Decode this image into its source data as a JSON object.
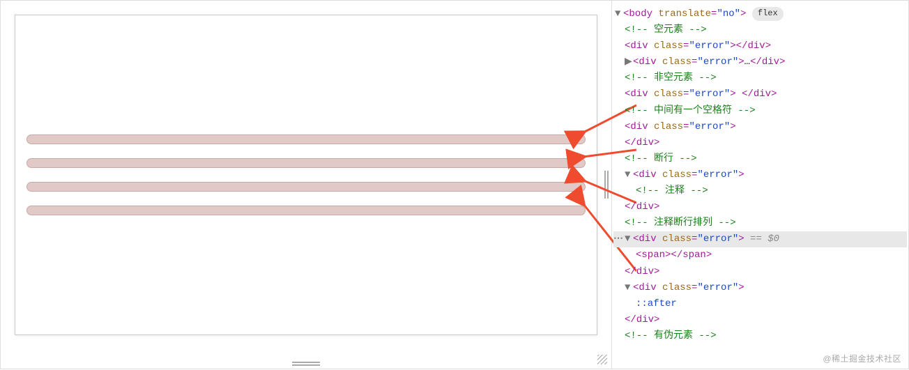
{
  "badge": "flex",
  "selection_marker": " == $0",
  "watermark": "@稀土掘金技术社区",
  "pseudo": "::after",
  "tags": {
    "body_open": "<body ",
    "attr_translate": "translate",
    "val_no": "\"no\"",
    "gt": ">",
    "div_open": "<div ",
    "attr_class": "class",
    "val_error": "\"error\"",
    "div_close": "</div>",
    "mid_close_open": "><",
    "slashdiv": "/div>",
    "span_open": "<span>",
    "span_close": "</span>",
    "ellipsis": "…"
  },
  "comments": {
    "empty_el": "<!-- 空元素 -->",
    "nonempty_el": "<!-- 非空元素 -->",
    "one_space": "<!-- 中间有一个空格符 -->",
    "line_break": "<!-- 断行 -->",
    "comment_inside": "<!-- 注释 -->",
    "comment_break": "<!-- 注释断行排列 -->",
    "has_pseudo": "<!-- 有伪元素 -->"
  }
}
